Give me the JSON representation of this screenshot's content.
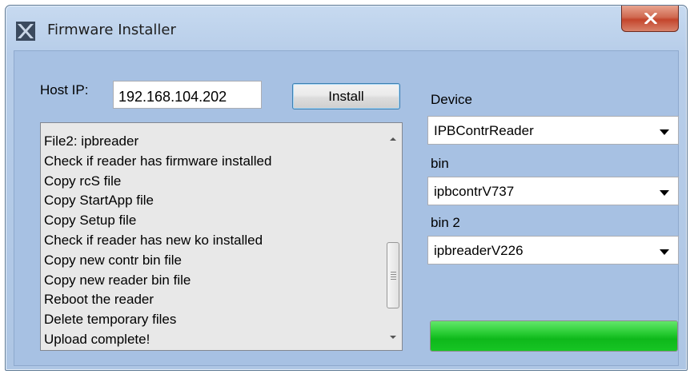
{
  "window": {
    "title": "Firmware Installer",
    "close_symbol": "X"
  },
  "host": {
    "label": "Host IP:",
    "value": "192.168.104.202"
  },
  "install_button": {
    "label": "Install"
  },
  "log": {
    "lines": [
      "File2: ipbreader",
      "Check if reader has firmware installed",
      "Copy rcS file",
      "Copy StartApp file",
      "Copy Setup file",
      "Check if reader has new ko installed",
      "Copy new contr bin file",
      "Copy new reader bin file",
      "Reboot the reader",
      "Delete temporary files",
      "Upload complete!"
    ]
  },
  "device": {
    "label": "Device",
    "selected": "IPBContrReader"
  },
  "bin": {
    "label": "bin",
    "selected": "ipbcontrV737"
  },
  "bin2": {
    "label": "bin 2",
    "selected": "ipbreaderV226"
  },
  "progress": {
    "value_percent": 100,
    "color": "#17c524"
  }
}
